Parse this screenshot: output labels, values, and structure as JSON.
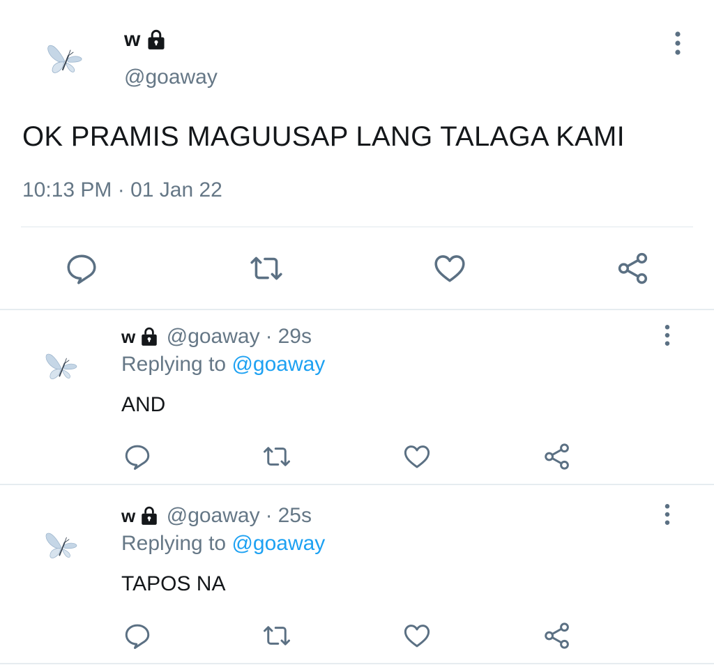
{
  "main_tweet": {
    "display_name": "w",
    "handle": "@goaway",
    "text": "OK PRAMIS MAGUUSAP LANG TALAGA KAMI",
    "timestamp": "10:13 PM · 01 Jan 22"
  },
  "replies": [
    {
      "display_name": "w",
      "handle": "@goaway",
      "separator": "·",
      "time": "29s",
      "replying_prefix": "Replying to ",
      "replying_to": "@goaway",
      "text": "AND"
    },
    {
      "display_name": "w",
      "handle": "@goaway",
      "separator": "·",
      "time": "25s",
      "replying_prefix": "Replying to ",
      "replying_to": "@goaway",
      "text": "TAPOS NA"
    }
  ],
  "icons": [
    "butterfly-avatar-icon",
    "lock-icon",
    "more-options-icon",
    "reply-icon",
    "retweet-icon",
    "like-icon",
    "share-icon"
  ],
  "colors": {
    "text": "#14171a",
    "secondary": "#657786",
    "link": "#1da1f2",
    "divider": "#e1e8ed",
    "icon": "#5b7083"
  }
}
